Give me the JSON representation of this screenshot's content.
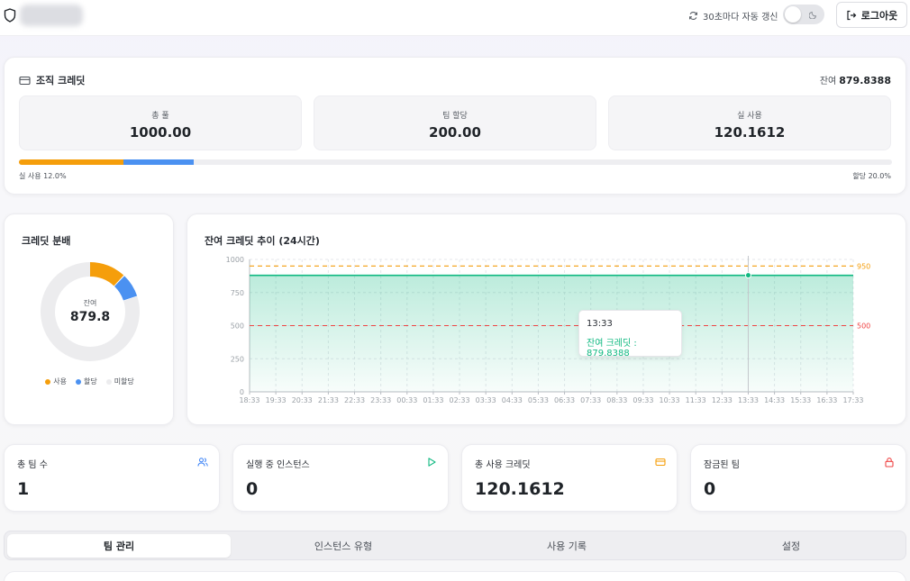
{
  "header": {
    "auto_refresh_label": "30초마다 자동 갱신",
    "logout_label": "로그아웃",
    "icons": [
      "shield-icon",
      "refresh-icon",
      "moon-icon",
      "logout-icon"
    ]
  },
  "org_credit": {
    "title": "조직 크레딧",
    "balance_label": "잔여",
    "balance_value": "879.8388",
    "stats": [
      {
        "label": "총 풀",
        "value": "1000.00"
      },
      {
        "label": "팀 할당",
        "value": "200.00"
      },
      {
        "label": "실 사용",
        "value": "120.1612"
      }
    ],
    "used_percent": 12.0,
    "allocated_percent": 20.0,
    "used_text": "실 사용 12.0%",
    "allocated_text": "할당 20.0%",
    "colors": {
      "used": "#f59e0b",
      "allocated": "#4b91f1",
      "track": "#eeeef1"
    }
  },
  "distribution": {
    "title": "크레딧 분배",
    "center_label": "잔여",
    "center_value": "879.8",
    "legend": [
      {
        "label": "사용",
        "color": "#f59e0b"
      },
      {
        "label": "할당",
        "color": "#4b91f1"
      },
      {
        "label": "미할당",
        "color": "#ececee"
      }
    ],
    "slices": [
      {
        "label": "사용",
        "value": 120.1612,
        "color": "#f59e0b"
      },
      {
        "label": "할당",
        "value": 79.8388,
        "color": "#4b91f1"
      },
      {
        "label": "미할당",
        "value": 800.0,
        "color": "#ececee"
      }
    ]
  },
  "trend": {
    "title": "잔여 크레딧 추이 (24시간)",
    "tooltip_time": "13:33",
    "tooltip_text": "잔여 크레딧 : 879.8388"
  },
  "chart_data": {
    "type": "area",
    "title": "잔여 크레딧 추이 (24시간)",
    "x": [
      "18:33",
      "19:33",
      "20:33",
      "21:33",
      "22:33",
      "23:33",
      "00:33",
      "01:33",
      "02:33",
      "03:33",
      "04:33",
      "05:33",
      "06:33",
      "07:33",
      "08:33",
      "09:33",
      "10:33",
      "11:33",
      "12:33",
      "13:33",
      "14:33",
      "15:33",
      "16:33",
      "17:33"
    ],
    "series": [
      {
        "name": "잔여 크레딧",
        "color": "#10b981",
        "values": [
          879.8388,
          879.8388,
          879.8388,
          879.8388,
          879.8388,
          879.8388,
          879.8388,
          879.8388,
          879.8388,
          879.8388,
          879.8388,
          879.8388,
          879.8388,
          879.8388,
          879.8388,
          879.8388,
          879.8388,
          879.8388,
          879.8388,
          879.8388,
          879.8388,
          879.8388,
          879.8388,
          879.8388
        ]
      }
    ],
    "yticks": [
      0,
      250,
      500,
      750,
      1000
    ],
    "ylim": [
      0,
      1000
    ],
    "reference_lines": [
      {
        "value": 950,
        "label": "950",
        "color": "#f59e0b"
      },
      {
        "value": 500,
        "label": "500",
        "color": "#ef4444"
      }
    ],
    "highlight_index": 19,
    "grid": true
  },
  "metrics": [
    {
      "label": "총 팀 수",
      "value": "1",
      "icon": "users-icon",
      "color": "#3b82f6"
    },
    {
      "label": "실행 중 인스턴스",
      "value": "0",
      "icon": "play-icon",
      "color": "#10b981"
    },
    {
      "label": "총 사용 크레딧",
      "value": "120.1612",
      "icon": "credit-card-icon",
      "color": "#f59e0b"
    },
    {
      "label": "잠금된 팀",
      "value": "0",
      "icon": "lock-icon",
      "color": "#ef4444"
    }
  ],
  "tabs": [
    {
      "label": "팀 관리",
      "active": true
    },
    {
      "label": "인스턴스 유형",
      "active": false
    },
    {
      "label": "사용 기록",
      "active": false
    },
    {
      "label": "설정",
      "active": false
    }
  ]
}
